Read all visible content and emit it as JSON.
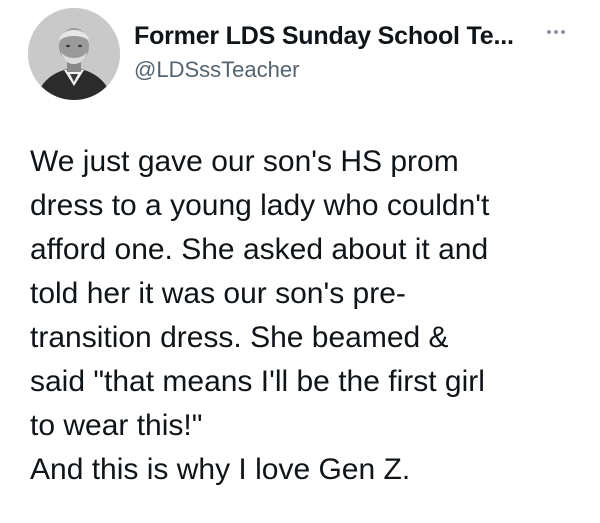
{
  "author": {
    "display_name": "Former LDS Sunday School Te...",
    "handle": "@LDSssTeacher",
    "avatar_icon": "portrait-photo"
  },
  "more_icon": "more-options-icon",
  "tweet": {
    "lines": [
      "We just gave our son's HS prom",
      "dress to a young lady who couldn't",
      "afford one. She asked about it and",
      "told her it was our son's pre-",
      "transition dress. She beamed &",
      "said \"that means I'll be the first girl",
      "to wear this!\""
    ],
    "closing": "And this is why I love Gen Z."
  }
}
